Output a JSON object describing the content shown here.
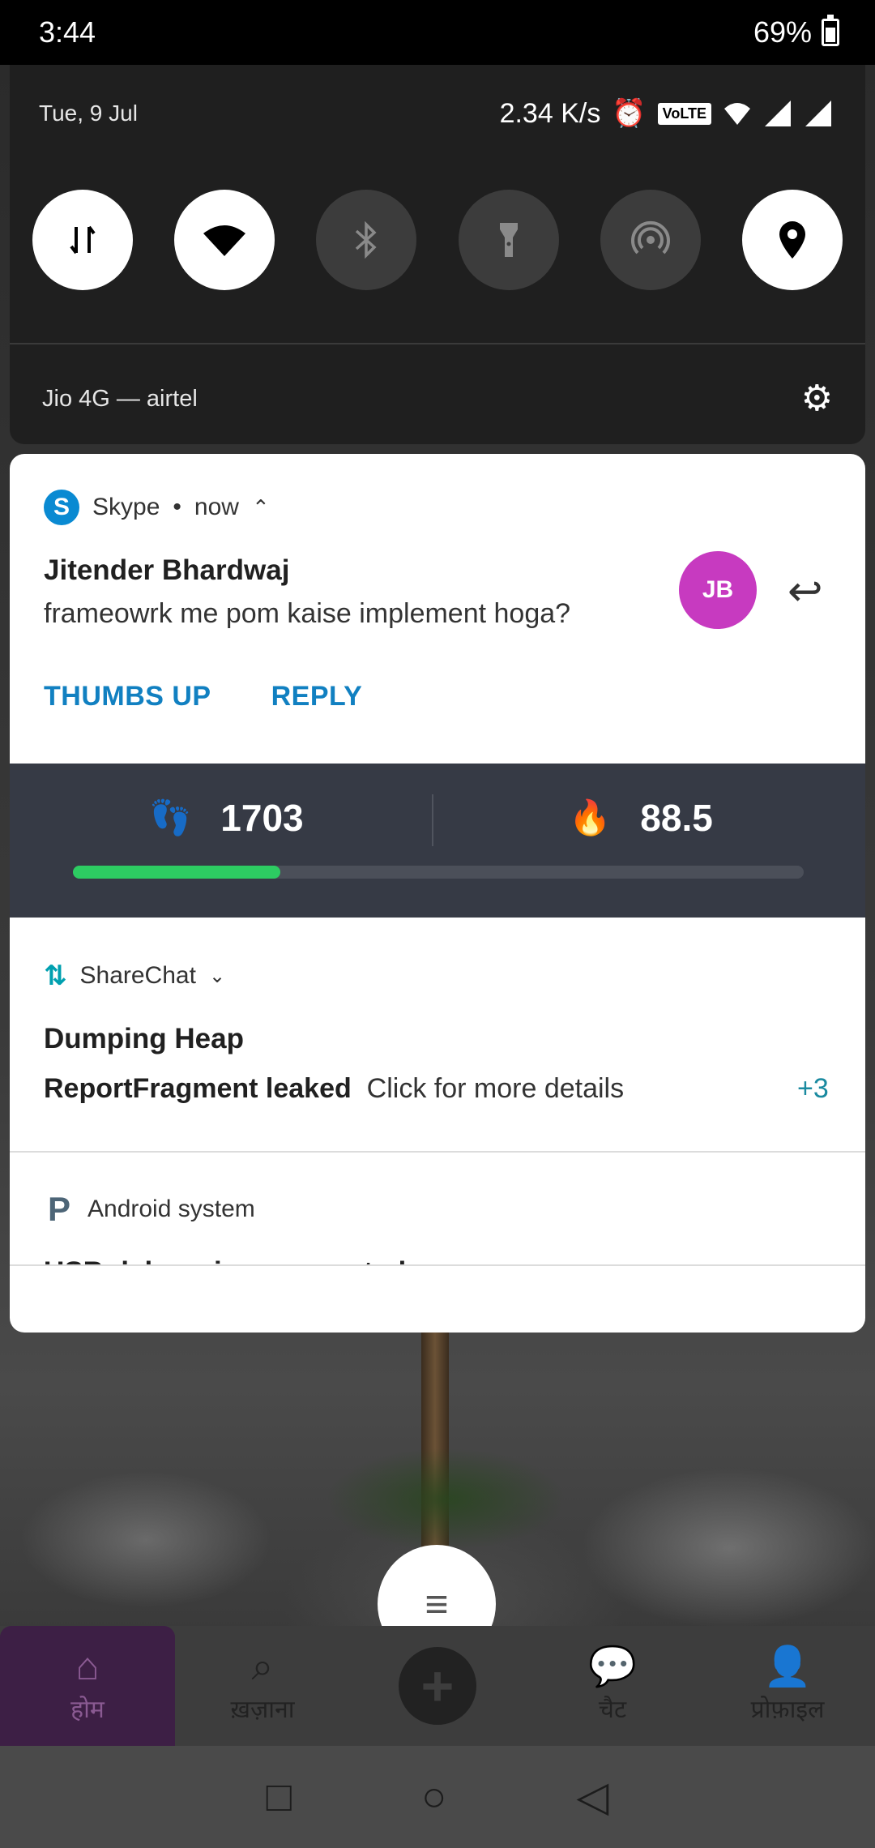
{
  "status_bar": {
    "time": "3:44",
    "battery": "69%"
  },
  "quick_settings": {
    "date": "Tue, 9 Jul",
    "speed": "2.34 K/s",
    "volte": "VoLTE",
    "network": "Jio 4G — airtel",
    "tiles": [
      {
        "name": "mobile-data",
        "on": true
      },
      {
        "name": "wifi",
        "on": true
      },
      {
        "name": "bluetooth",
        "on": false
      },
      {
        "name": "flashlight",
        "on": false
      },
      {
        "name": "hotspot",
        "on": false
      },
      {
        "name": "location",
        "on": true
      }
    ]
  },
  "skype_notification": {
    "app_name": "Skype",
    "time": "now",
    "sender": "Jitender Bhardwaj",
    "message": "frameowrk me pom kaise implement hoga?",
    "avatar_initials": "JB",
    "avatar_color": "#c73ac0",
    "actions": [
      "THUMBS UP",
      "REPLY"
    ]
  },
  "fitness_widget": {
    "steps": "1703",
    "calories": "88.5",
    "progress_fraction": 0.284
  },
  "sharechat_notification": {
    "app_name": "ShareChat",
    "title": "Dumping Heap",
    "bold_text": "ReportFragment leaked",
    "text": "Click for more details",
    "more_count": "+3"
  },
  "android_notification": {
    "app_name": "Android system",
    "title": "USB debugging connected"
  },
  "bottom_nav": {
    "items": [
      "होम",
      "ख़ज़ाना",
      "",
      "चैट",
      "प्रोफ़ाइल"
    ]
  },
  "colors": {
    "accent": "#1180c1",
    "progress": "#2dcc62",
    "fitness_bg": "#363a45"
  }
}
